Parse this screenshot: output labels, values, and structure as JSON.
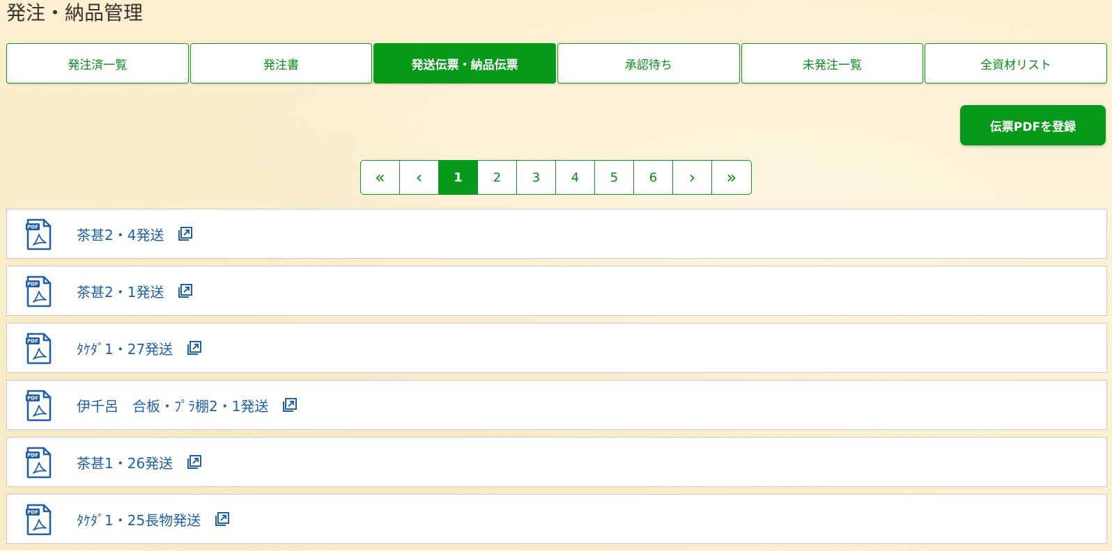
{
  "page": {
    "title": "発注・納品管理"
  },
  "tabs": [
    {
      "label": "発注済一覧",
      "active": false
    },
    {
      "label": "発注書",
      "active": false
    },
    {
      "label": "発送伝票・納品伝票",
      "active": true
    },
    {
      "label": "承認待ち",
      "active": false
    },
    {
      "label": "未発注一覧",
      "active": false
    },
    {
      "label": "全資材リスト",
      "active": false
    }
  ],
  "register_button": {
    "label": "伝票PDFを登録"
  },
  "pagination": {
    "first": "«",
    "prev": "‹",
    "pages": [
      "1",
      "2",
      "3",
      "4",
      "5",
      "6"
    ],
    "current": "1",
    "next": "›",
    "last": "»"
  },
  "documents": [
    {
      "name": "茶甚2・4発送",
      "icon": "pdf-file-icon",
      "link_icon": "open-external-icon"
    },
    {
      "name": "茶甚2・1発送",
      "icon": "pdf-file-icon",
      "link_icon": "open-external-icon"
    },
    {
      "name": "ﾀｹﾀﾞ1・27発送",
      "icon": "pdf-file-icon",
      "link_icon": "open-external-icon"
    },
    {
      "name": "伊千呂　合板・ﾌﾟﾗ棚2・1発送",
      "icon": "pdf-file-icon",
      "link_icon": "open-external-icon"
    },
    {
      "name": "茶甚1・26発送",
      "icon": "pdf-file-icon",
      "link_icon": "open-external-icon"
    },
    {
      "name": "ﾀｹﾀﾞ1・25長物発送",
      "icon": "pdf-file-icon",
      "link_icon": "open-external-icon"
    }
  ],
  "colors": {
    "accent": "#07991a",
    "link": "#1f5fa8",
    "background": "#fbefcf"
  }
}
